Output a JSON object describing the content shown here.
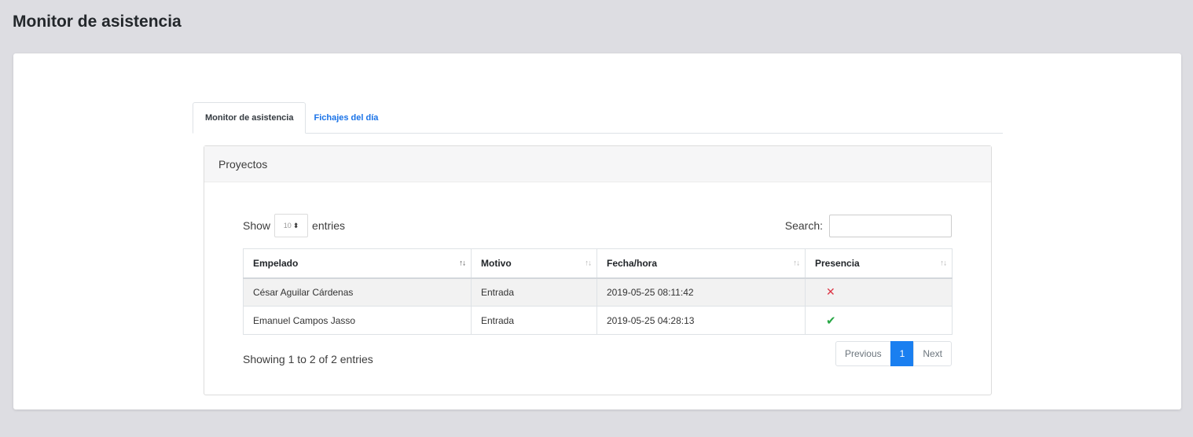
{
  "page": {
    "title": "Monitor de asistencia"
  },
  "tabs": [
    {
      "label": "Monitor de asistencia",
      "active": true
    },
    {
      "label": "Fichajes del día",
      "active": false
    }
  ],
  "panel": {
    "title": "Proyectos"
  },
  "length": {
    "prefix": "Show",
    "value": "10",
    "suffix": "entries"
  },
  "search": {
    "label": "Search:",
    "value": ""
  },
  "table": {
    "headers": [
      "Empelado",
      "Motivo",
      "Fecha/hora",
      "Presencia"
    ],
    "rows": [
      {
        "empleado": "César Aguilar Cárdenas",
        "motivo": "Entrada",
        "fecha": "2019-05-25 08:11:42",
        "presencia": "absent"
      },
      {
        "empleado": "Emanuel Campos Jasso",
        "motivo": "Entrada",
        "fecha": "2019-05-25 04:28:13",
        "presencia": "present"
      }
    ]
  },
  "info": "Showing 1 to 2 of 2 entries",
  "pagination": {
    "previous": "Previous",
    "current": "1",
    "next": "Next"
  },
  "icons": {
    "absent": "close-icon",
    "present": "check-icon",
    "sort": "sort-arrows-icon"
  },
  "colors": {
    "accent": "#1a7ff0",
    "absent": "#dc3545",
    "present": "#28a745"
  }
}
